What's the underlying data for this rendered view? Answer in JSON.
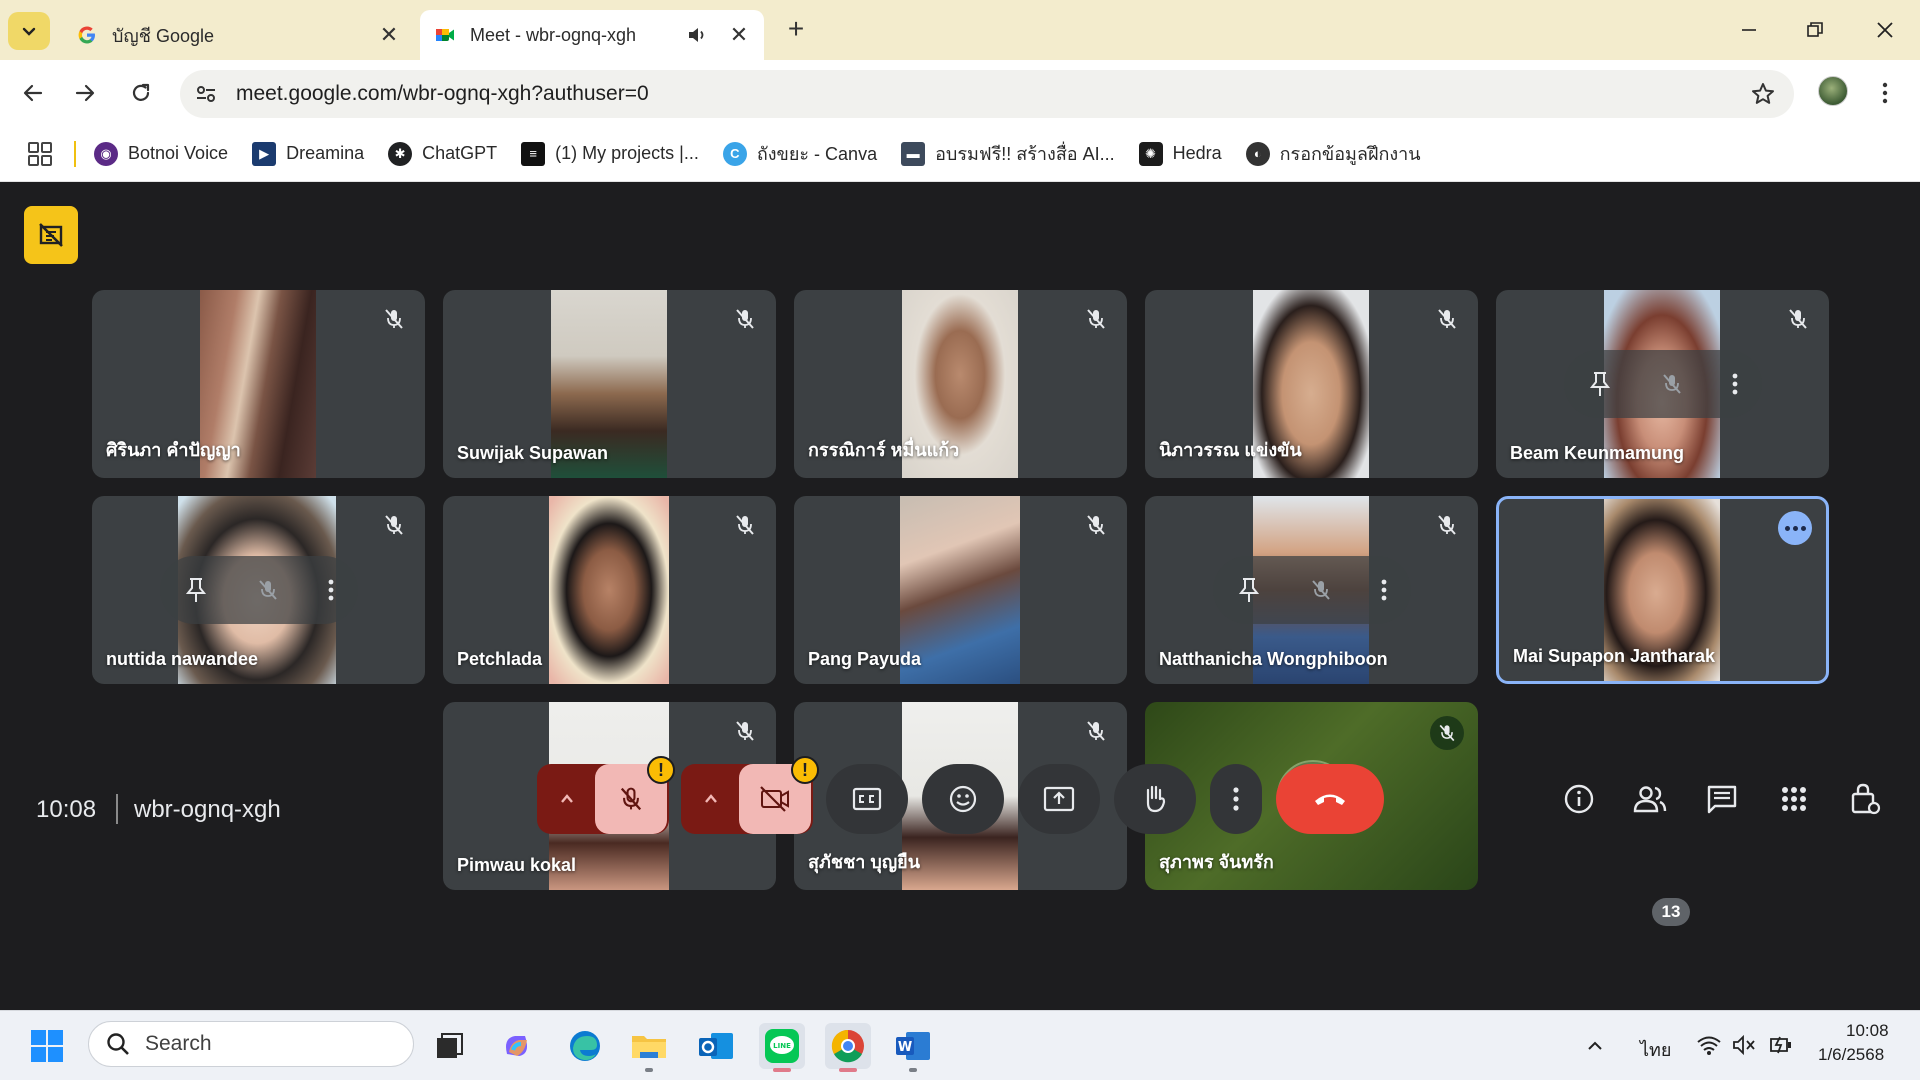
{
  "browser": {
    "tabs": [
      {
        "title": "บัญชี Google",
        "active": false
      },
      {
        "title": "Meet - wbr-ognq-xgh",
        "active": true
      }
    ],
    "url": "meet.google.com/wbr-ognq-xgh?authuser=0",
    "bookmarks": [
      {
        "label": "Botnoi Voice",
        "icon": "botnoi-icon",
        "color": "#5b2a86"
      },
      {
        "label": "Dreamina",
        "icon": "dreamina-icon",
        "color": "#1b3b6f"
      },
      {
        "label": "ChatGPT",
        "icon": "chatgpt-icon",
        "color": "#202123"
      },
      {
        "label": "(1) My projects |...",
        "icon": "projects-icon",
        "color": "#111111"
      },
      {
        "label": "ถังขยะ - Canva",
        "icon": "canva-icon",
        "color": "#3aa4e8"
      },
      {
        "label": "อบรมฟรี!! สร้างสื่อ AI...",
        "icon": "laptop-icon",
        "color": "#3d4a5c"
      },
      {
        "label": "Hedra",
        "icon": "hedra-icon",
        "color": "#1c1c1c"
      },
      {
        "label": "กรอกข้อมูลฝึกงาน",
        "icon": "globe-icon",
        "color": "#333333"
      }
    ]
  },
  "meet": {
    "time": "10:08",
    "meeting_code": "wbr-ognq-xgh",
    "participants_count": "13",
    "participants": [
      {
        "name": "ศิรินภา คำปัญญา"
      },
      {
        "name": "Suwijak Supawan"
      },
      {
        "name": "กรรณิการ์ หมื่นแก้ว"
      },
      {
        "name": "นิภาวรรณ แข่งขัน"
      },
      {
        "name": "Beam Keunmamung"
      },
      {
        "name": "nuttida nawandee"
      },
      {
        "name": "Petchlada"
      },
      {
        "name": "Pang Payuda"
      },
      {
        "name": "Natthanicha Wongphiboon"
      },
      {
        "name": "Mai Supapon Jantharak"
      },
      {
        "name": "Pimwau kokal"
      },
      {
        "name": "สุภัชชา บุญยืน"
      },
      {
        "name": "สุภาพร จันทรัก"
      }
    ],
    "warning_symbol": "!"
  },
  "taskbar": {
    "search_placeholder": "Search",
    "language": "ไทย",
    "clock_time": "10:08",
    "clock_date": "1/6/2568"
  },
  "colors": {
    "meet_bg": "#1d1d1f",
    "tile_bg": "#3c4043",
    "leave_red": "#ea4335",
    "muted_pink": "#f2b8b5",
    "focus_blue": "#8ab4f8",
    "badge_yellow": "#f5c419"
  }
}
